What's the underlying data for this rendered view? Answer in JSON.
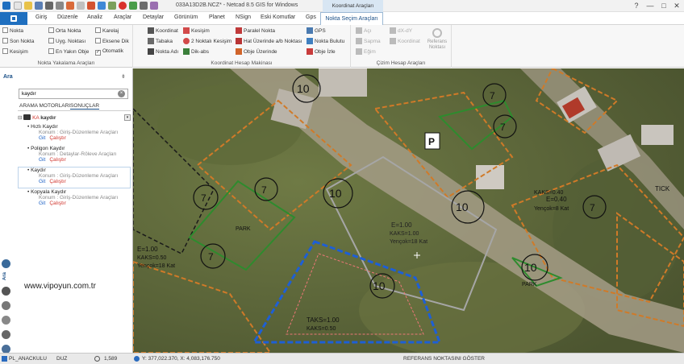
{
  "window": {
    "title": "033A13D2B.NCZ* - Netcad 8.5 GIS for Windows",
    "context_tab_header": "Koordinat Araçları",
    "controls": [
      "?",
      "—",
      "□",
      "✕"
    ]
  },
  "tabs": [
    "Giriş",
    "Düzenle",
    "Analiz",
    "Araçlar",
    "Detaylar",
    "Görünüm",
    "Planet",
    "NSign",
    "Eski Komutlar",
    "Gps"
  ],
  "active_tab": "Nokta Seçim Araçları",
  "ribbon": {
    "snap_group": {
      "label": "Nokta Yakalama Araçları",
      "items": [
        {
          "label": "Nokta",
          "checked": false
        },
        {
          "label": "Orta Nokta",
          "checked": false
        },
        {
          "label": "Karelaj",
          "checked": false
        },
        {
          "label": "Son Nokta",
          "checked": false
        },
        {
          "label": "Uyg. Noktası",
          "checked": false
        },
        {
          "label": "Eksene Dik",
          "checked": false
        },
        {
          "label": "Kesişim",
          "checked": false
        },
        {
          "label": "En Yakın Obje",
          "checked": false
        },
        {
          "label": "Otomatik",
          "checked": true
        }
      ]
    },
    "coord_group": {
      "label": "Koordinat Hesap Makinası",
      "items": [
        "Koordinat",
        "Kesişim",
        "Paralel Nokta",
        "GPS",
        "Tabaka",
        "2 Noktalı Kesişim",
        "Hat Üzerinde a/b Noktası",
        "Nokta Bulutu",
        "Nokta Adı",
        "Dik-abs",
        "Obje Üzerinde",
        "Obje İzle"
      ]
    },
    "draw_group": {
      "label": "Çizim Hesap Araçları",
      "items": [
        "Açı",
        "dX-dY",
        "Sapma",
        "Koordinat",
        "Eğim"
      ],
      "ref_button": "Referans Noktası"
    }
  },
  "sidebar": {
    "title": "Ara",
    "pin": "⇟",
    "search": {
      "value": "kaydır",
      "placeholder": ""
    },
    "tabs": [
      "ARAMA MOTORLARI",
      "SONUÇLAR"
    ],
    "root": {
      "tag": "KA",
      "label": "kaydır"
    },
    "results": [
      {
        "title": "Hızlı Kaydır",
        "location": "Konum : Giriş-Düzenleme Araçları",
        "go": "Git",
        "run": "Çalıştır"
      },
      {
        "title": "Poligon Kaydır",
        "location": "Konum : Detaylar-Röleve Araçları",
        "go": "Git",
        "run": "Çalıştır"
      },
      {
        "title": "Kaydır",
        "location": "Konum : Giriş-Düzenleme Araçları",
        "go": "Git",
        "run": "Çalıştır"
      },
      {
        "title": "Kopyala Kaydır",
        "location": "Konum : Giriş-Düzenleme Araçları",
        "go": "Git",
        "run": "Çalıştır"
      }
    ],
    "rail_label": "Ara",
    "watermark": "www.vipoyun.com.tr"
  },
  "map": {
    "labels": [
      "10",
      "7",
      "7",
      "10",
      "7",
      "7",
      "10",
      "10",
      "7",
      "10",
      "7",
      "PARK",
      "PARK",
      "P",
      "TICK",
      "E=0.40",
      "Yençok=8 Kat",
      "KAKS=0.40",
      "E=1.00",
      "KAKS=1.00",
      "Yençok=18 Kat",
      "E=1.00",
      "KAKS=0.50",
      "Yençok=18 Kat",
      "TAKS=1.00",
      "KAKS=0.50"
    ]
  },
  "status": {
    "layer": "PL_ANACKULU",
    "mode": "DUZ",
    "scale": "1,589",
    "coords": "Y: 377,022.370, X: 4,083,176.750",
    "hint": "REFERANS NOKTASINI GÖSTER"
  }
}
